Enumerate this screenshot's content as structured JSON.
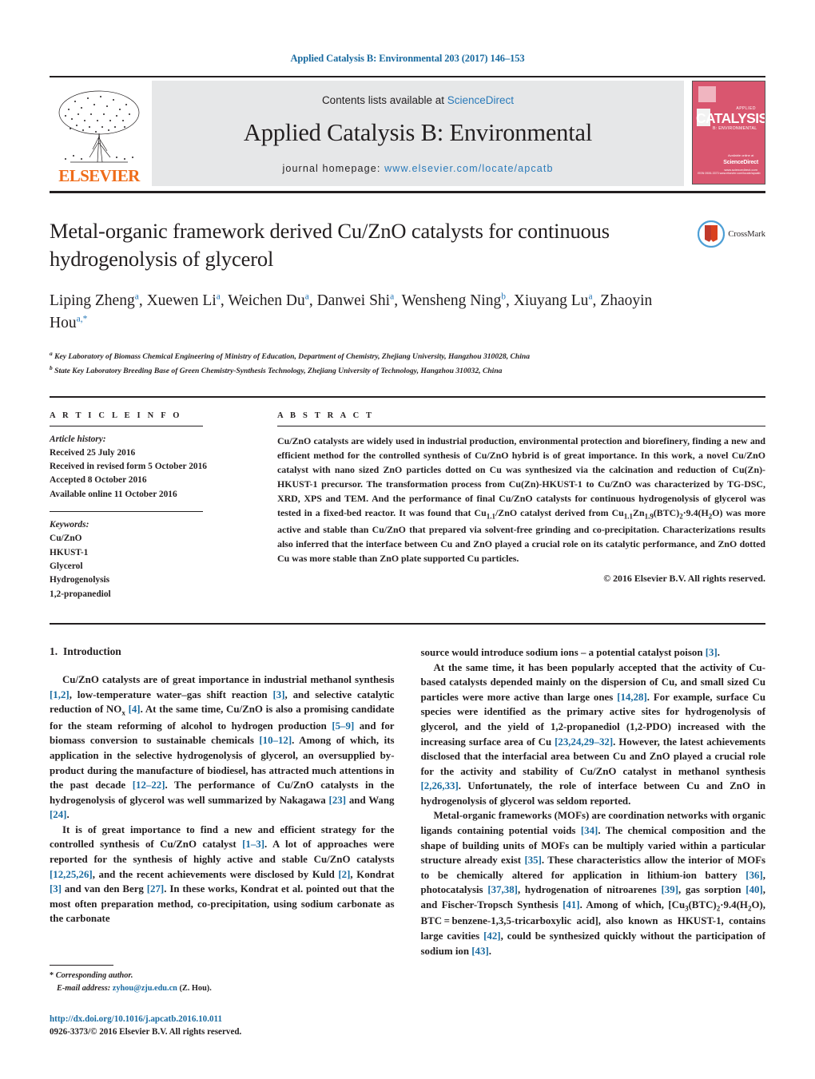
{
  "running_head": "Applied Catalysis B: Environmental 203 (2017) 146–153",
  "masthead": {
    "publisher_name": "ELSEVIER",
    "contents_prefix": "Contents lists available at ",
    "contents_link": "ScienceDirect",
    "journal_title": "Applied Catalysis B: Environmental",
    "homepage_prefix": "journal homepage: ",
    "homepage_url": "www.elsevier.com/locate/apcatb",
    "cover": {
      "applied_label": "APPLIED",
      "main_label": "CATALYSIS",
      "sub_label": "B: ENVIRONMENTAL",
      "footer_right_top": "Available online at",
      "footer_right_logo": "ScienceDirect",
      "footer_right_bottom": "www.sciencedirect.com",
      "footer_left": "ISSN 0926-3373\nwww.elsevier.com/locate/apcatb",
      "bg_color": "#d9566f"
    }
  },
  "article": {
    "title": "Metal-organic framework derived Cu/ZnO catalysts for continuous hydrogenolysis of glycerol",
    "crossmark_label": "CrossMark",
    "authors": [
      {
        "name": "Liping Zheng",
        "sup": "a"
      },
      {
        "name": "Xuewen Li",
        "sup": "a"
      },
      {
        "name": "Weichen Du",
        "sup": "a"
      },
      {
        "name": "Danwei Shi",
        "sup": "a"
      },
      {
        "name": "Wensheng Ning",
        "sup": "b"
      },
      {
        "name": "Xiuyang Lu",
        "sup": "a"
      },
      {
        "name": "Zhaoyin Hou",
        "sup": "a,*"
      }
    ],
    "affiliations": [
      {
        "mark": "a",
        "text": "Key Laboratory of Biomass Chemical Engineering of Ministry of Education, Department of Chemistry, Zhejiang University, Hangzhou 310028, China"
      },
      {
        "mark": "b",
        "text": "State Key Laboratory Breeding Base of Green Chemistry-Synthesis Technology, Zhejiang University of Technology, Hangzhou 310032, China"
      }
    ]
  },
  "info": {
    "heading": "A R T I C L E   I N F O",
    "history_label": "Article history:",
    "history": [
      "Received 25 July 2016",
      "Received in revised form 5 October 2016",
      "Accepted 8 October 2016",
      "Available online 11 October 2016"
    ],
    "keywords_label": "Keywords:",
    "keywords": [
      "Cu/ZnO",
      "HKUST-1",
      "Glycerol",
      "Hydrogenolysis",
      "1,2-propanediol"
    ]
  },
  "abstract": {
    "heading": "A B S T R A C T",
    "text": "Cu/ZnO catalysts are widely used in industrial production, environmental protection and biorefinery, finding a new and efficient method for the controlled synthesis of Cu/ZnO hybrid is of great importance. In this work, a novel Cu/ZnO catalyst with nano sized ZnO particles dotted on Cu was synthesized via the calcination and reduction of Cu(Zn)-HKUST-1 precursor. The transformation process from Cu(Zn)-HKUST-1 to Cu/ZnO was characterized by TG-DSC, XRD, XPS and TEM. And the performance of final Cu/ZnO catalysts for continuous hydrogenolysis of glycerol was tested in a fixed-bed reactor. It was found that Cu1.1/ZnO catalyst derived from Cu1.1Zn1.9(BTC)2·9.4(H2O) was more active and stable than Cu/ZnO that prepared via solvent-free grinding and co-precipitation. Characterizations results also inferred that the interface between Cu and ZnO played a crucial role on its catalytic performance, and ZnO dotted Cu was more stable than ZnO plate supported Cu particles.",
    "copyright": "© 2016 Elsevier B.V. All rights reserved."
  },
  "introduction": {
    "number": "1.",
    "title": "Introduction",
    "paragraphs_left": [
      "Cu/ZnO catalysts are of great importance in industrial methanol synthesis [1,2], low-temperature water–gas shift reaction [3], and selective catalytic reduction of NOx [4]. At the same time, Cu/ZnO is also a promising candidate for the steam reforming of alcohol to hydrogen production [5–9] and for biomass conversion to sustainable chemicals [10–12]. Among of which, its application in the selective hydrogenolysis of glycerol, an oversupplied by-product during the manufacture of biodiesel, has attracted much attentions in the past decade [12–22]. The performance of Cu/ZnO catalysts in the hydrogenolysis of glycerol was well summarized by Nakagawa [23] and Wang [24].",
      "It is of great importance to find a new and efficient strategy for the controlled synthesis of Cu/ZnO catalyst [1–3]. A lot of approaches were reported for the synthesis of highly active and stable Cu/ZnO catalysts [12,25,26], and the recent achievements were disclosed by Kuld [2], Kondrat [3] and van den Berg [27]. In these works, Kondrat et al. pointed out that the most often preparation method, co-precipitation, using sodium carbonate as the carbonate"
    ],
    "paragraphs_right": [
      "source would introduce sodium ions – a potential catalyst poison [3].",
      "At the same time, it has been popularly accepted that the activity of Cu-based catalysts depended mainly on the dispersion of Cu, and small sized Cu particles were more active than large ones [14,28]. For example, surface Cu species were identified as the primary active sites for hydrogenolysis of glycerol, and the yield of 1,2-propanediol (1,2-PDO) increased with the increasing surface area of Cu [23,24,29–32]. However, the latest achievements disclosed that the interfacial area between Cu and ZnO played a crucial role for the activity and stability of Cu/ZnO catalyst in methanol synthesis [2,26,33]. Unfortunately, the role of interface between Cu and ZnO in hydrogenolysis of glycerol was seldom reported.",
      "Metal-organic frameworks (MOFs) are coordination networks with organic ligands containing potential voids [34]. The chemical composition and the shape of building units of MOFs can be multiply varied within a particular structure already exist [35]. These characteristics allow the interior of MOFs to be chemically altered for application in lithium-ion battery [36], photocatalysis [37,38], hydrogenation of nitroarenes [39], gas sorption [40], and Fischer-Tropsch Synthesis [41]. Among of which, [Cu3(BTC)2·9.4(H2O), BTC = benzene-1,3,5-tricarboxylic acid], also known as HKUST-1, contains large cavities [42], could be synthesized quickly without the participation of sodium ion [43]."
    ]
  },
  "footnote": {
    "corresponding_marker": "*",
    "corresponding_text": "Corresponding author.",
    "email_label": "E-mail address:",
    "email": "zyhou@zju.edu.cn",
    "email_suffix": "(Z. Hou).",
    "doi": "http://dx.doi.org/10.1016/j.apcatb.2016.10.011",
    "issn": "0926-3373/© 2016 Elsevier B.V. All rights reserved."
  },
  "colors": {
    "link": "#1a6ba0",
    "sciencedirect": "#2a7ab9",
    "elsevier_orange": "#ef6c19",
    "masthead_bg": "#e6e7e8",
    "cover_pink": "#d9566f"
  }
}
